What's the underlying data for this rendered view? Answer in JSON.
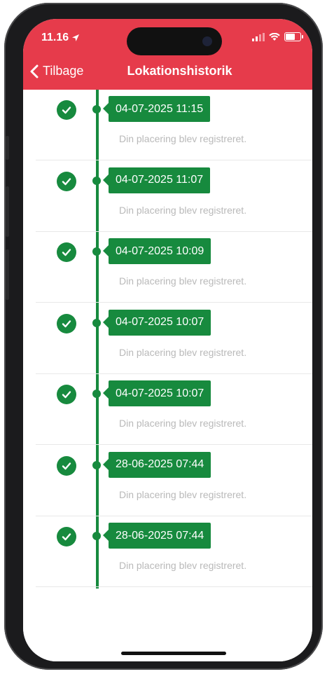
{
  "status_bar": {
    "time": "11.16"
  },
  "nav": {
    "back_label": "Tilbage",
    "title": "Lokationshistorik"
  },
  "entries": [
    {
      "timestamp": "04-07-2025 11:15",
      "message": "Din placering blev registreret."
    },
    {
      "timestamp": "04-07-2025 11:07",
      "message": "Din placering blev registreret."
    },
    {
      "timestamp": "04-07-2025 10:09",
      "message": "Din placering blev registreret."
    },
    {
      "timestamp": "04-07-2025 10:07",
      "message": "Din placering blev registreret."
    },
    {
      "timestamp": "04-07-2025 10:07",
      "message": "Din placering blev registreret."
    },
    {
      "timestamp": "28-06-2025 07:44",
      "message": "Din placering blev registreret."
    },
    {
      "timestamp": "28-06-2025 07:44",
      "message": "Din placering blev registreret."
    }
  ],
  "colors": {
    "header": "#e63b4b",
    "accent": "#178a3e",
    "muted_text": "#b9b9b9"
  }
}
